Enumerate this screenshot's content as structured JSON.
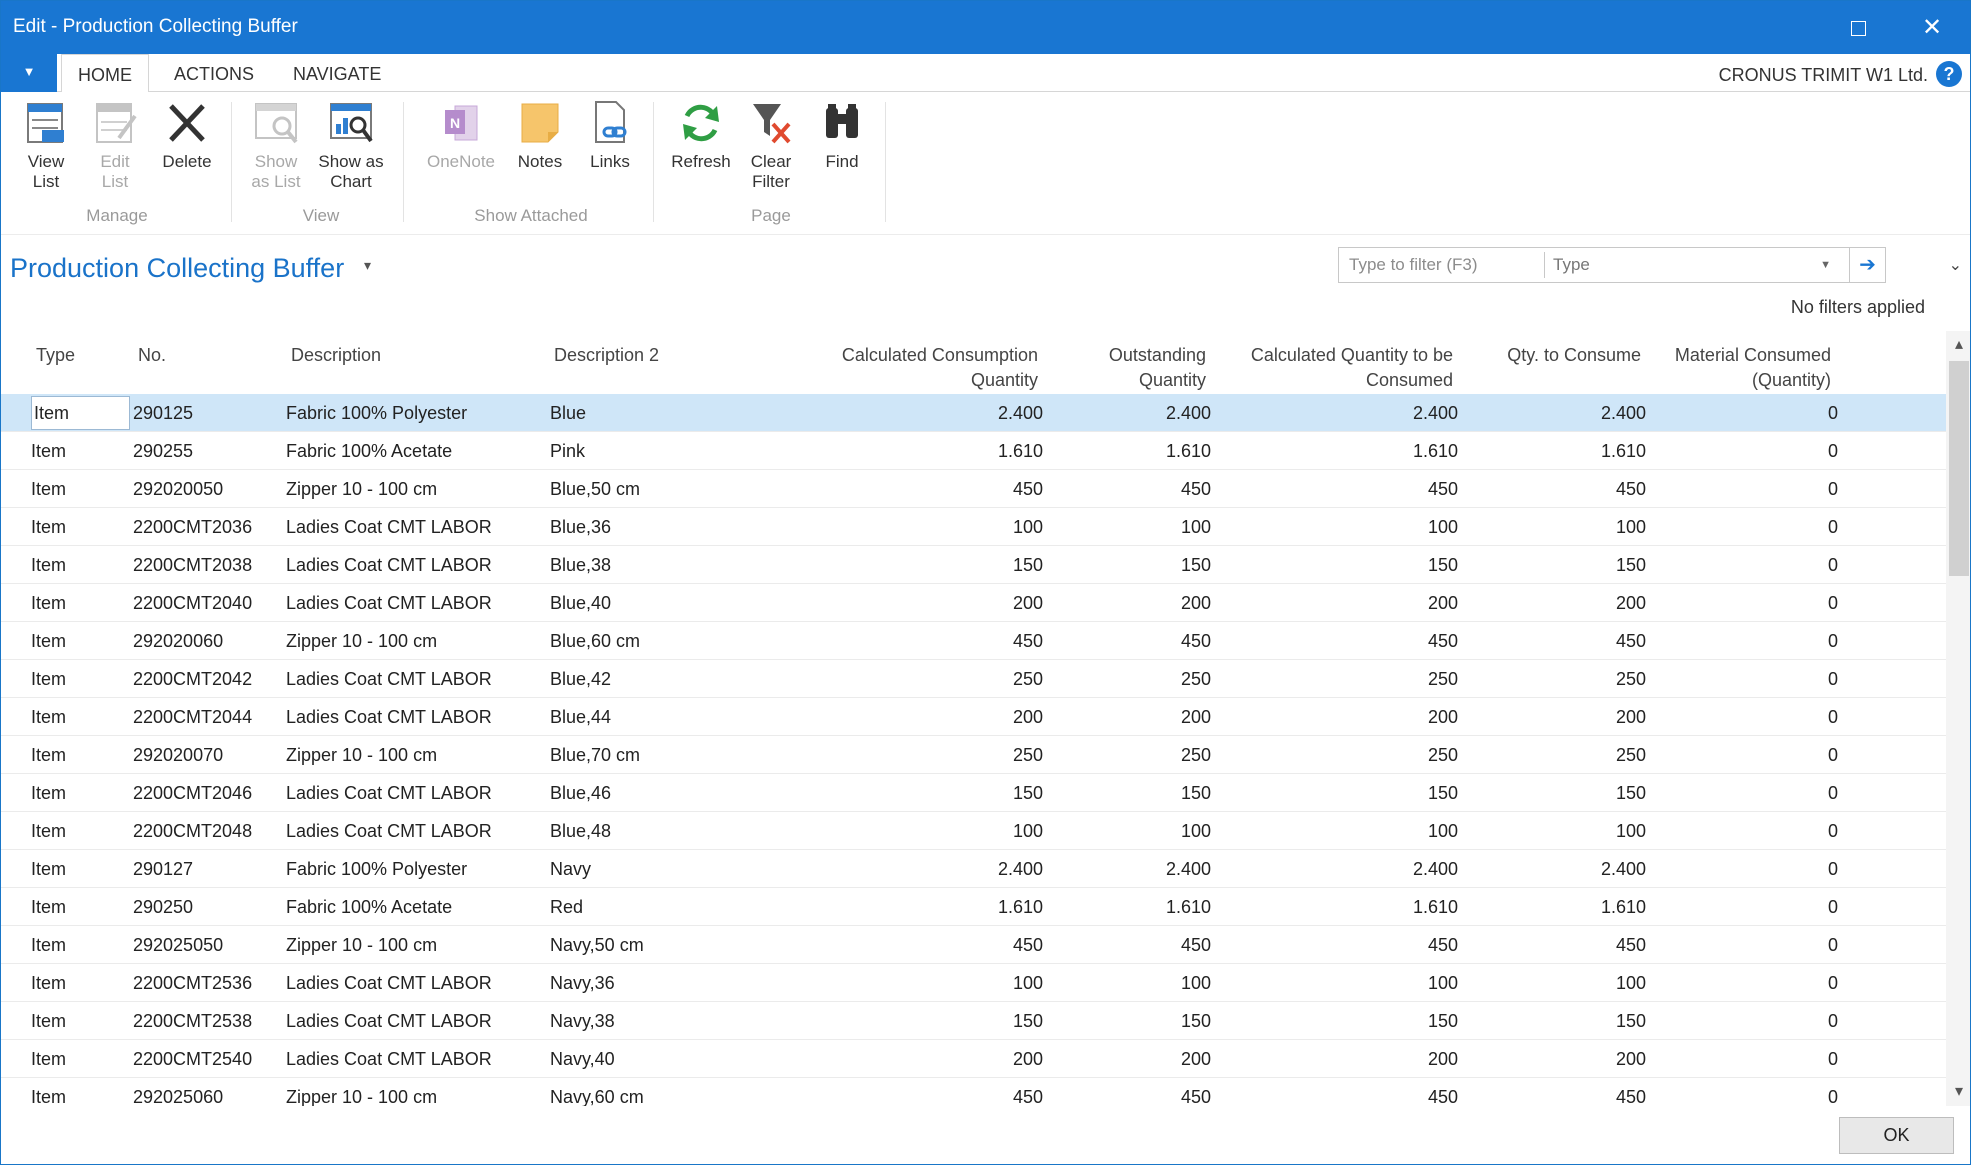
{
  "window": {
    "title": "Edit - Production Collecting Buffer",
    "maximize_label": "",
    "close_label": "✕"
  },
  "ribbon_tabs": [
    "HOME",
    "ACTIONS",
    "NAVIGATE"
  ],
  "app_menu_glyph": "▼",
  "company": "CRONUS TRIMIT W1 Ltd.",
  "help_glyph": "?",
  "ribbon": {
    "groups": [
      {
        "label": "Manage",
        "buttons": [
          {
            "label": "View\nList",
            "icon": "view-list-icon",
            "enabled": true
          },
          {
            "label": "Edit\nList",
            "icon": "edit-list-icon",
            "enabled": false
          },
          {
            "label": "Delete",
            "icon": "delete-icon",
            "enabled": true
          }
        ]
      },
      {
        "label": "View",
        "buttons": [
          {
            "label": "Show\nas List",
            "icon": "show-as-list-icon",
            "enabled": false
          },
          {
            "label": "Show as\nChart",
            "icon": "show-as-chart-icon",
            "enabled": true
          }
        ]
      },
      {
        "label": "Show Attached",
        "buttons": [
          {
            "label": "OneNote",
            "icon": "onenote-icon",
            "enabled": false
          },
          {
            "label": "Notes",
            "icon": "notes-icon",
            "enabled": true
          },
          {
            "label": "Links",
            "icon": "links-icon",
            "enabled": true
          }
        ]
      },
      {
        "label": "Page",
        "buttons": [
          {
            "label": "Refresh",
            "icon": "refresh-icon",
            "enabled": true
          },
          {
            "label": "Clear\nFilter",
            "icon": "clear-filter-icon",
            "enabled": true
          },
          {
            "label": "Find",
            "icon": "find-binoculars-icon",
            "enabled": true
          }
        ]
      }
    ]
  },
  "page": {
    "title": "Production Collecting Buffer",
    "title_caret": "▾",
    "filter": {
      "placeholder": "Type to filter (F3)",
      "field": "Type",
      "dropdown_glyph": "▼",
      "go_glyph": "➔"
    },
    "collapse_glyph": "⌄",
    "filter_status": "No filters applied"
  },
  "grid": {
    "headers": {
      "type": "Type",
      "no": "No.",
      "description": "Description",
      "description2": "Description 2",
      "calc_consumption": [
        "Calculated Consumption",
        "Quantity"
      ],
      "outstanding": [
        "Outstanding",
        "Quantity"
      ],
      "calc_to_consume": [
        "Calculated Quantity to be",
        "Consumed"
      ],
      "qty_to_consume": "Qty. to Consume",
      "material_consumed": [
        "Material Consumed",
        "(Quantity)"
      ]
    },
    "selected_row": 0,
    "rows": [
      [
        "Item",
        "290125",
        "Fabric 100% Polyester",
        "Blue",
        "2.400",
        "2.400",
        "2.400",
        "2.400",
        "0"
      ],
      [
        "Item",
        "290255",
        "Fabric 100% Acetate",
        "Pink",
        "1.610",
        "1.610",
        "1.610",
        "1.610",
        "0"
      ],
      [
        "Item",
        "292020050",
        "Zipper 10 - 100 cm",
        "Blue,50 cm",
        "450",
        "450",
        "450",
        "450",
        "0"
      ],
      [
        "Item",
        "2200CMT2036",
        "Ladies Coat CMT LABOR",
        "Blue,36",
        "100",
        "100",
        "100",
        "100",
        "0"
      ],
      [
        "Item",
        "2200CMT2038",
        "Ladies Coat CMT LABOR",
        "Blue,38",
        "150",
        "150",
        "150",
        "150",
        "0"
      ],
      [
        "Item",
        "2200CMT2040",
        "Ladies Coat CMT LABOR",
        "Blue,40",
        "200",
        "200",
        "200",
        "200",
        "0"
      ],
      [
        "Item",
        "292020060",
        "Zipper 10 - 100 cm",
        "Blue,60 cm",
        "450",
        "450",
        "450",
        "450",
        "0"
      ],
      [
        "Item",
        "2200CMT2042",
        "Ladies Coat CMT LABOR",
        "Blue,42",
        "250",
        "250",
        "250",
        "250",
        "0"
      ],
      [
        "Item",
        "2200CMT2044",
        "Ladies Coat CMT LABOR",
        "Blue,44",
        "200",
        "200",
        "200",
        "200",
        "0"
      ],
      [
        "Item",
        "292020070",
        "Zipper 10 - 100 cm",
        "Blue,70 cm",
        "250",
        "250",
        "250",
        "250",
        "0"
      ],
      [
        "Item",
        "2200CMT2046",
        "Ladies Coat CMT LABOR",
        "Blue,46",
        "150",
        "150",
        "150",
        "150",
        "0"
      ],
      [
        "Item",
        "2200CMT2048",
        "Ladies Coat CMT LABOR",
        "Blue,48",
        "100",
        "100",
        "100",
        "100",
        "0"
      ],
      [
        "Item",
        "290127",
        "Fabric 100% Polyester",
        "Navy",
        "2.400",
        "2.400",
        "2.400",
        "2.400",
        "0"
      ],
      [
        "Item",
        "290250",
        "Fabric 100% Acetate",
        "Red",
        "1.610",
        "1.610",
        "1.610",
        "1.610",
        "0"
      ],
      [
        "Item",
        "292025050",
        "Zipper 10 - 100 cm",
        "Navy,50 cm",
        "450",
        "450",
        "450",
        "450",
        "0"
      ],
      [
        "Item",
        "2200CMT2536",
        "Ladies Coat CMT LABOR",
        "Navy,36",
        "100",
        "100",
        "100",
        "100",
        "0"
      ],
      [
        "Item",
        "2200CMT2538",
        "Ladies Coat CMT LABOR",
        "Navy,38",
        "150",
        "150",
        "150",
        "150",
        "0"
      ],
      [
        "Item",
        "2200CMT2540",
        "Ladies Coat CMT LABOR",
        "Navy,40",
        "200",
        "200",
        "200",
        "200",
        "0"
      ],
      [
        "Item",
        "292025060",
        "Zipper 10 - 100 cm",
        "Navy,60 cm",
        "450",
        "450",
        "450",
        "450",
        "0"
      ]
    ]
  },
  "scroll": {
    "up_glyph": "▴",
    "down_glyph": "▾"
  },
  "footer": {
    "ok_label": "OK"
  },
  "colors": {
    "accent": "#1976d2",
    "selection": "#cfe6f8",
    "title_link": "#1a73c9"
  }
}
